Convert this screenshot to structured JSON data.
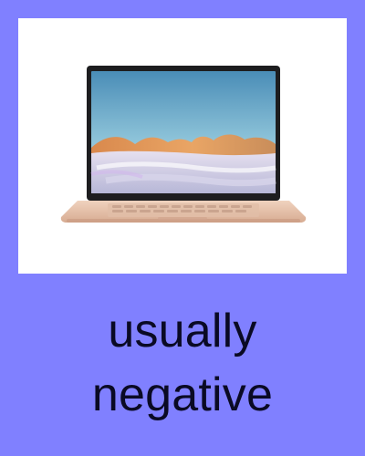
{
  "card": {
    "caption_lines": [
      "usually",
      "negative"
    ],
    "image_subject": "laptop-image"
  },
  "colors": {
    "background": "#8080ff",
    "image_frame": "#ffffff",
    "caption_text": "#0a0a24",
    "laptop_body": "#e8c6ad",
    "screen_bezel": "#1d1d1f",
    "screen_sky": "#67a9c8"
  }
}
